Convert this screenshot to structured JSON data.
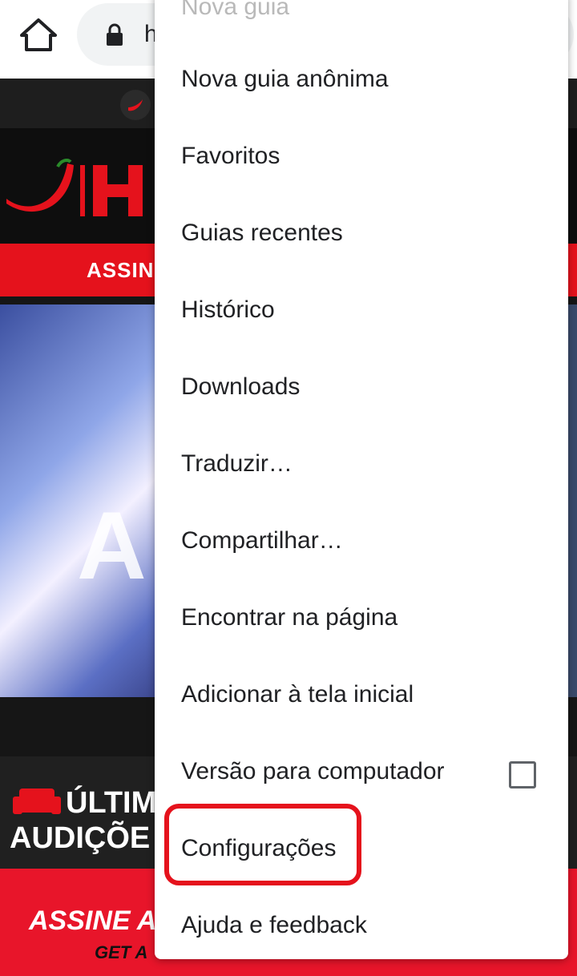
{
  "toolbar": {
    "url_partial": "h"
  },
  "site": {
    "subscribe_label": "ASSIN",
    "hero_letter": "A",
    "promo_line1": "ÚLTIM",
    "promo_line2": "AUDIÇÕE",
    "promo_bottom": "ASSINE AC",
    "promo_bottom_sub": "GET A"
  },
  "menu": {
    "items": [
      {
        "label": "Nova guia"
      },
      {
        "label": "Nova guia anônima"
      },
      {
        "label": "Favoritos"
      },
      {
        "label": "Guias recentes"
      },
      {
        "label": "Histórico"
      },
      {
        "label": "Downloads"
      },
      {
        "label": "Traduzir…"
      },
      {
        "label": "Compartilhar…"
      },
      {
        "label": "Encontrar na página"
      },
      {
        "label": "Adicionar à tela inicial"
      },
      {
        "label": "Versão para computador",
        "checked": false
      },
      {
        "label": "Configurações",
        "highlighted": true
      },
      {
        "label": "Ajuda e feedback"
      }
    ]
  },
  "colors": {
    "highlight": "#e5121c",
    "menu_text": "#202124",
    "accent_red": "#e5121c"
  }
}
